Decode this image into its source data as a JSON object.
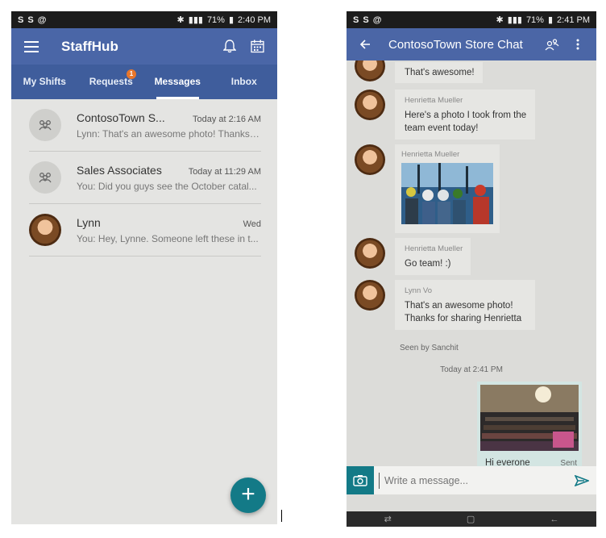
{
  "left": {
    "status": {
      "carriers": [
        "S",
        "S",
        "@"
      ],
      "battery": "71%",
      "time": "2:40 PM"
    },
    "app_title": "StaffHub",
    "tabs": [
      {
        "label": "My Shifts"
      },
      {
        "label": "Requests",
        "badge": "1"
      },
      {
        "label": "Messages"
      },
      {
        "label": "Inbox"
      }
    ],
    "conversations": [
      {
        "name": "ContosoTown S...",
        "time": "Today at 2:16 AM",
        "preview": "Lynn: That's an awesome photo! Thanks f...",
        "avatar": "group-icon"
      },
      {
        "name": "Sales Associates",
        "time": "Today at 11:29 AM",
        "preview": "You: Did you guys see the October catal...",
        "avatar": "group-icon"
      },
      {
        "name": "Lynn",
        "time": "Wed",
        "preview": "You: Hey, Lynne. Someone left these in t...",
        "avatar": "photo"
      }
    ],
    "fab": "+"
  },
  "right": {
    "status": {
      "carriers": [
        "S",
        "S",
        "@"
      ],
      "battery": "71%",
      "time": "2:41 PM"
    },
    "chat_title": "ContosoTown Store Chat",
    "messages": [
      {
        "sender": "",
        "text": "That's awesome!"
      },
      {
        "sender": "Henrietta Mueller",
        "text": "Here's a photo I took from the team event today!"
      },
      {
        "sender": "Henrietta Mueller",
        "text": "",
        "image": "team-kayak-photo"
      },
      {
        "sender": "Henrietta Mueller",
        "text": "Go team! :)"
      },
      {
        "sender": "Lynn Vo",
        "text": "That's an awesome photo! Thanks for sharing Henrietta"
      }
    ],
    "seen_by": "Seen by Sanchit",
    "timestamp": "Today at 2:41 PM",
    "outgoing": {
      "text": "Hi everone",
      "image": "conference-hall-photo",
      "status": "Sent"
    },
    "compose_placeholder": "Write a message..."
  },
  "colors": {
    "app_bar": "#4a66a7",
    "tab_bar": "#3f5d9c",
    "accent": "#137a87",
    "badge": "#e8762b"
  }
}
